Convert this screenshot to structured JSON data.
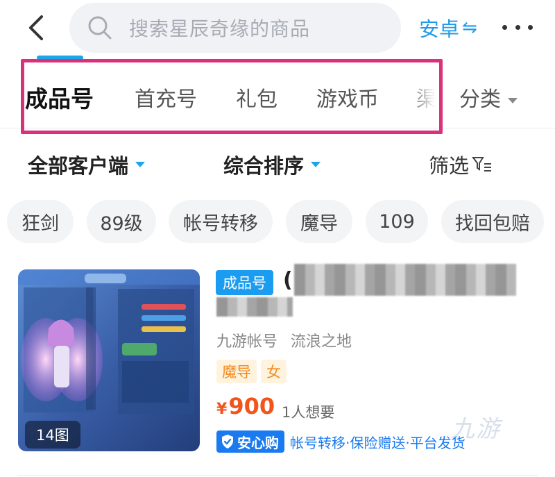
{
  "topbar": {
    "search_placeholder": "搜索星辰奇缘的商品",
    "platform_label": "安卓",
    "platform_swap_glyph": "⇋"
  },
  "tabs": [
    "成品号",
    "首充号",
    "礼包",
    "游戏币",
    "渠"
  ],
  "category_button": "分类",
  "filters": {
    "client": "全部客户端",
    "sort": "综合排序",
    "filter": "筛选"
  },
  "chips": [
    "狂剑",
    "89级",
    "帐号转移",
    "魔导",
    "109",
    "找回包赔"
  ],
  "product": {
    "image_count": "14图",
    "type_tag": "成品号",
    "title_partial": "(",
    "seller": "九游帐号",
    "server": "流浪之地",
    "attributes": [
      "魔导",
      "女"
    ],
    "price_symbol": "¥",
    "price": "900",
    "wants": "1人想要",
    "guarantee_badge": "安心购",
    "guarantee_text": "帐号转移·保险赠送·平台发货"
  },
  "colors": {
    "accent": "#1aa6e8",
    "price": "#f2541b",
    "highlight": "#d9327a",
    "attr_text": "#f28a1e"
  }
}
